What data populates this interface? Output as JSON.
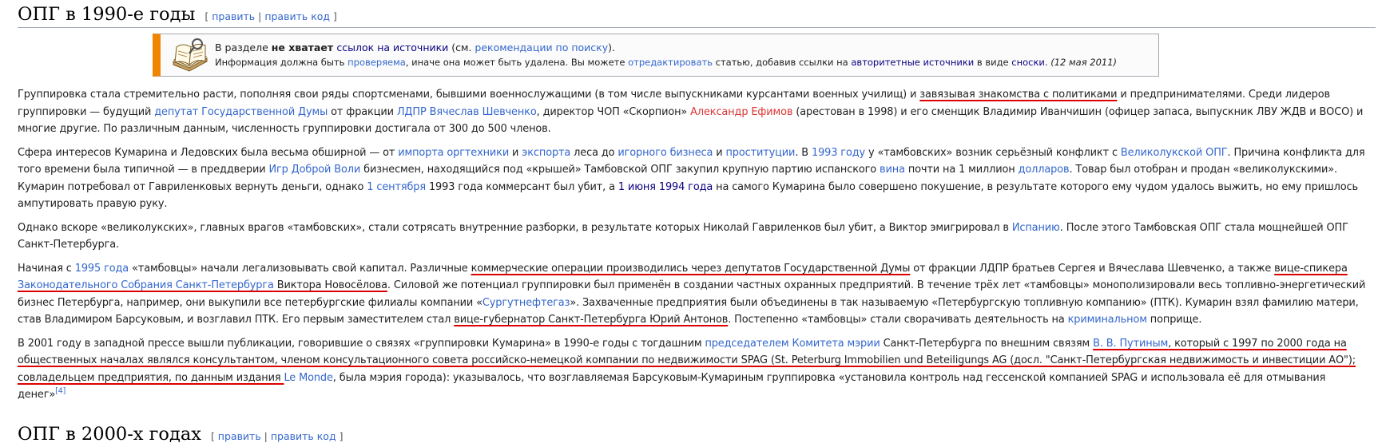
{
  "section1": {
    "title": "ОПГ в 1990-е годы",
    "edit_open": "[ ",
    "edit": "править",
    "edit_sep": " | ",
    "edit_code": "править код",
    "edit_close": " ]"
  },
  "notice": {
    "icon": "book-icon",
    "line1": {
      "t1": "В разделе ",
      "bold": "не хватает ",
      "link1": "ссылок на источники",
      "t2": " (см. ",
      "link2": "рекомендации по поиску",
      "t3": ")."
    },
    "line2": {
      "t1": "Информация должна быть ",
      "l1": "проверяема",
      "t2": ", иначе она может быть удалена. Вы можете ",
      "l2": "отредактировать",
      "t3": " статью, добавив ссылки на ",
      "l3": "авторитетные источники",
      "t4": " в виде ",
      "l4": "сноски",
      "t5": ". ",
      "date": "(12 мая 2011)"
    }
  },
  "p1": {
    "t1": "Группировка стала стремительно расти, пополняя свои ряды спортсменами, бывшими военнослужащими (в том числе выпускниками курсантами военных училищ) и ",
    "u1": "завязывая знакомства с политиками",
    "t2": " и предпринимателями. Среди лидеров группировки — будущий ",
    "l1": "депутат Государственной Думы",
    "t3": " от фракции ",
    "l2": "ЛДПР",
    "t4": " ",
    "l3": "Вячеслав Шевченко",
    "t5": ", директор ЧОП «Скорпион» ",
    "l4": "Александр Ефимов",
    "t6": " (арестован в 1998) и его сменщик Владимир Иванчишин (офицер запаса, выпускник ЛВУ ЖДВ и ВОСО) и многие другие. По различным данным, численность группировки достигала от 300 до 500 членов."
  },
  "p2": {
    "t1": "Сфера интересов Кумарина и Ледовских была весьма обширной — от ",
    "l1": "импорта",
    "t2": " ",
    "l2": "оргтехники",
    "t3": " и ",
    "l3": "экспорта",
    "t4": " леса до ",
    "l4": "игорного бизнеса",
    "t5": " и ",
    "l5": "проституции",
    "t6": ". В ",
    "l6": "1993 году",
    "t7": " у «тамбовских» возник серьёзный конфликт с ",
    "l7": "Великолукской ОПГ",
    "t8": ". Причина конфликта для того времени была типичной — в преддверии ",
    "l8": "Игр Доброй Воли",
    "t9": " бизнесмен, находящийся под «крышей» Тамбовской ОПГ закупил крупную партию испанского ",
    "l9": "вина",
    "t10": " почти на 1 миллион ",
    "l10": "долларов",
    "t11": ". Товар был отобран и продан «великолукскими». Кумарин потребовал от Гавриленковых вернуть деньги, однако ",
    "l11": "1 сентября",
    "t12": " 1993 года коммерсант был убит, а ",
    "l12": "1 июня",
    "t13": " ",
    "l13": "1994 года",
    "t14": " на самого Кумарина было совершено покушение, в результате которого ему чудом удалось выжить, но ему пришлось ампутировать правую руку."
  },
  "p3": {
    "t1": "Однако вскоре «великолукских», главных врагов «тамбовских», стали сотрясать внутренние разборки, в результате которых Николай Гавриленков был убит, а Виктор эмигрировал в ",
    "l1": "Испанию",
    "t2": ". После этого Тамбовская ОПГ стала мощнейшей ОПГ Санкт-Петербурга."
  },
  "p4": {
    "t1": "Начиная с ",
    "l1": "1995 года",
    "t2": " «тамбовцы» начали легализовывать свой капитал. Различные ",
    "u1": "коммерческие операции производились через депутатов Государственной Думы",
    "t3": " от фракции ЛДПР братьев Сергея и Вячеслава Шевченко, а также ",
    "u2": "вице-спикера ",
    "lu1": "Законодательного Собрания Санкт-Петербурга",
    "u3": " Виктора Новосёлова",
    "t4": ". Силовой же потенциал группировки был применён в создании частных охранных предприятий. В течение трёх лет «тамбовцы» монополизировали весь топливно-энергетический бизнес Петербурга, например, они выкупили все петербургские филиалы компании «",
    "l2": "Сургутнефтегаз",
    "t5": "». Захваченные предприятия были объединены в так называемую «Петербургскую топливную компанию» (ПТК). Кумарин взял фамилию матери, став Владимиром Барсуковым, и возглавил ПТК. Его первым заместителем стал ",
    "u4": "вице-губернатор Санкт-Петербурга Юрий Антонов",
    "t6": ". Постепенно «тамбовцы» стали сворачивать деятельность на ",
    "l3": "криминальном",
    "t7": " поприще."
  },
  "p5": {
    "t1": "В 2001 году в западной прессе вышли публикации, говорившие о связях «группировки Кумарина» в 1990-е годы с тогдашним ",
    "l1": "председателем Комитета мэрии",
    "t2": " Санкт-Петербурга по внешним связям ",
    "l2": "В. В. Путиным",
    "t3": ", который с 1997 по 2000 года на общественных началах являлся консультантом, членом консультационного совета российско-немецкой компании по недвижимости SPAG (St. Peterburg Immobilien und Beteiligungs AG (досл. \"Санкт-Петербургская недвижимость и инвестиции АО\"); совладельцем предприятия, по данным издания ",
    "l3": "Le Monde",
    "t4": ", была мэрия города): указывалось, что возглавляемая Барсуковым-Кумариным группировка «установила контроль над гессенской компанией SPAG и использовала её для отмывания денег»",
    "ref": "[4]"
  },
  "section2": {
    "title": "ОПГ в 2000-х годах",
    "edit_open": "[ ",
    "edit": "править",
    "edit_sep": " | ",
    "edit_code": "править код",
    "edit_close": " ]"
  },
  "colors": {
    "link": "#3366cc",
    "redlink": "#d33",
    "visited": "#0b0080",
    "underline_mark": "#d00",
    "notice_bar": "#f28500"
  }
}
